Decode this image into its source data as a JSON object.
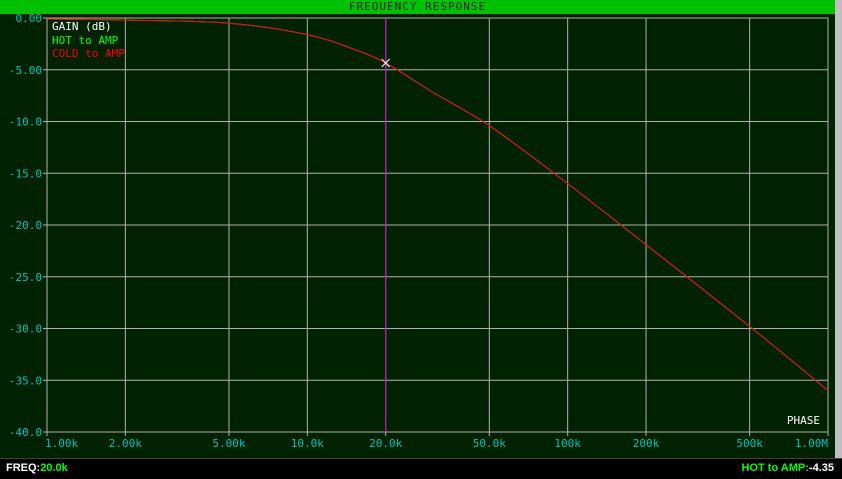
{
  "window": {
    "title": "FREQUENCY RESPONSE"
  },
  "chart_data": {
    "type": "line",
    "title": "FREQUENCY RESPONSE",
    "ylabel": "GAIN (dB)",
    "y2label": "PHASE",
    "xscale": "log",
    "xlim": [
      1000,
      1000000
    ],
    "ylim": [
      -40,
      0
    ],
    "grid": true,
    "legend_position": "top-left",
    "xticks": [
      1000,
      2000,
      5000,
      10000,
      20000,
      50000,
      100000,
      200000,
      500000,
      1000000
    ],
    "xtick_labels": [
      "1.00k",
      "2.00k",
      "5.00k",
      "10.0k",
      "20.0k",
      "50.0k",
      "100k",
      "200k",
      "500k",
      "1.00M"
    ],
    "yticks": [
      0,
      -5,
      -10,
      -15,
      -20,
      -25,
      -30,
      -35,
      -40
    ],
    "ytick_labels": [
      "0.00",
      "-5.00",
      "-10.0",
      "-15.0",
      "-20.0",
      "-25.0",
      "-30.0",
      "-35.0",
      "-40.0"
    ],
    "series": [
      {
        "name": "HOT to AMP",
        "color": "#00ff00",
        "x": [
          1000,
          2000,
          5000,
          10000,
          15000,
          20000,
          30000,
          50000,
          100000,
          200000,
          500000,
          1000000
        ],
        "y": [
          -0.1,
          -0.2,
          -0.5,
          -1.6,
          -3.0,
          -4.35,
          -7.1,
          -10.4,
          -16.0,
          -21.9,
          -29.8,
          -36.0
        ]
      },
      {
        "name": "COLD to AMP",
        "color": "#ff0000",
        "x": [
          1000,
          2000,
          5000,
          10000,
          15000,
          20000,
          30000,
          50000,
          100000,
          200000,
          500000,
          1000000
        ],
        "y": [
          -0.1,
          -0.2,
          -0.5,
          -1.6,
          -3.0,
          -4.35,
          -7.1,
          -10.4,
          -16.0,
          -21.9,
          -29.8,
          -36.0
        ]
      }
    ],
    "cursor": {
      "x": 20000,
      "y": -4.35,
      "color": "#c000c0"
    }
  },
  "status": {
    "freq_label": "FREQ:",
    "freq_value": "20.0k",
    "readout_label": "HOT to AMP:",
    "readout_value": "-4.35"
  }
}
